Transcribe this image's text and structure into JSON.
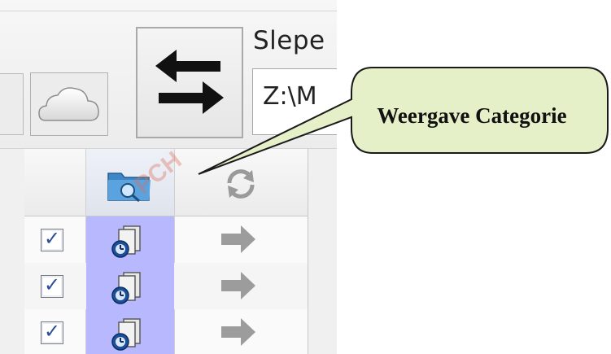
{
  "toolbar": {
    "sync_label": "Slepe",
    "path_value": "Z:\\M"
  },
  "callout": {
    "text": "Weergave Categorie",
    "fill": "#e6f0c8",
    "border": "#1a1a1a"
  },
  "watermark": "PCH",
  "grid": {
    "header_icons": [
      "folder-search-icon",
      "sync-refresh-icon"
    ],
    "rows": [
      {
        "checked": true,
        "category_icon": "schedule-task-icon",
        "direction_icon": "arrow-right-icon"
      },
      {
        "checked": true,
        "category_icon": "schedule-task-icon",
        "direction_icon": "arrow-right-icon"
      },
      {
        "checked": true,
        "category_icon": "schedule-task-icon",
        "direction_icon": "arrow-right-icon"
      }
    ],
    "check_glyph": "✓"
  },
  "colors": {
    "category_highlight": "#b8b8ff",
    "arrow_gray": "#9c9c9c"
  }
}
